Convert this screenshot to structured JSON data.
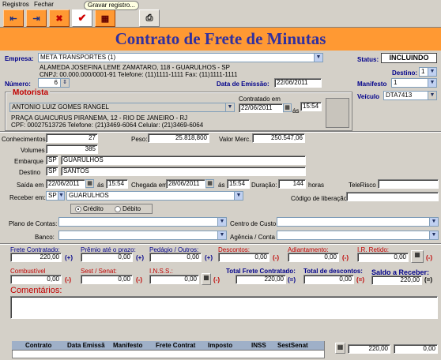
{
  "menu": {
    "registros": "Registros",
    "fechar": "Fechar"
  },
  "toolbar": {
    "tooltip": "Gravar registro..."
  },
  "title": "Contrato de Frete de Minutas",
  "empresa": {
    "label": "Empresa:",
    "value": "META TRANSPORTES (1)",
    "address": "ALAMEDA JOSEFINA LEME ZAMATARO, 118 - GUARULHOS - SP",
    "cnpj": "CNPJ: 00.000.000/0001-91 Telefone: (11)1111-1111 Fax: (11)1111-1111"
  },
  "status": {
    "label": "Status:",
    "value": "INCLUINDO"
  },
  "destino": {
    "label": "Destino:",
    "value": "1"
  },
  "manifesto": {
    "label": "Manifesto",
    "value": "1"
  },
  "veiculo": {
    "label": "Veículo",
    "value": "DTA7413"
  },
  "numero": {
    "label": "Número:",
    "value": "6"
  },
  "emissao": {
    "label": "Data de Emissão:",
    "value": "22/06/2011"
  },
  "motorista": {
    "label": "Motorista",
    "name": "ANTONIO LUIZ GOMES RANGEL",
    "address": "PRAÇA GUAICURUS PIRANEMA, 12 - RIO DE JANEIRO - RJ",
    "cpf": "CPF: 00027513726 Telefone: (21)3469-6064 Celular: (21)3469-6064",
    "contratado_label": "Contratado em",
    "contratado_date": "22/06/2011",
    "as": "ás",
    "contratado_time": "15:54"
  },
  "conhecimentos": {
    "label": "Conhecimentos:",
    "value": "27"
  },
  "peso": {
    "label": "Peso:",
    "value": "25.818,800"
  },
  "valor_merc": {
    "label": "Valor Merc.",
    "value": "250.547,06"
  },
  "volumes": {
    "label": "Volumes",
    "value": "385"
  },
  "embarque": {
    "label": "Embarque",
    "uf": "SP",
    "city": "GUARULHOS"
  },
  "destino2": {
    "label": "Destino",
    "uf": "SP",
    "city": "SANTOS"
  },
  "saida": {
    "label": "Saída em",
    "date": "22/06/2011",
    "as": "ás",
    "time": "15:54"
  },
  "chegada": {
    "label": "Chegada em",
    "date": "28/06/2011",
    "as": "ás",
    "time": "15:54"
  },
  "duracao": {
    "label": "Duração:",
    "value": "144",
    "unit": "horas"
  },
  "telerisco": {
    "label": "TeleRisco"
  },
  "receber": {
    "label": "Receber em:",
    "uf": "SP",
    "city": "GUARULHOS"
  },
  "codigo_lib": {
    "label": "Código de liberação"
  },
  "pagamento": {
    "credito": "Crédito",
    "debito": "Débito"
  },
  "plano_contas": {
    "label": "Plano de Contas:"
  },
  "centro_custo": {
    "label": "Centro de Custo"
  },
  "banco": {
    "label": "Banco:"
  },
  "agencia": {
    "label": "Agência / Conta"
  },
  "valores": {
    "frete_contratado": {
      "label": "Frete Contratado:",
      "value": "220,00",
      "sign": "(+)"
    },
    "premio": {
      "label": "Prêmio até o prazo:",
      "value": "0,00",
      "sign": "(+)"
    },
    "pedagio": {
      "label": "Pedágio / Outros:",
      "value": "0,00",
      "sign": "(+)"
    },
    "descontos": {
      "label": "Descontos:",
      "value": "0,00",
      "sign": "(-)"
    },
    "adiantamento": {
      "label": "Adiantamento:",
      "value": "0,00",
      "sign": "(-)"
    },
    "ir_retido": {
      "label": "I.R. Retido:",
      "value": "0,00",
      "sign": "(-)"
    },
    "combustivel": {
      "label": "Combustível",
      "value": "0,00",
      "sign": "(-)"
    },
    "sest_senat": {
      "label": "Sest / Senat:",
      "value": "0,00",
      "sign": "(-)"
    },
    "inss": {
      "label": "I.N.S.S.:",
      "value": "0,00"
    },
    "total_frete": {
      "label": "Total Frete Contratado:",
      "value": "220,00",
      "sign": "(=)"
    },
    "total_descontos": {
      "label": "Total de descontos:",
      "value": "0,00",
      "sign": "(=)"
    },
    "saldo": {
      "label": "Saldo a Receber:",
      "value": "220,00",
      "sign": "(=)"
    }
  },
  "comentarios": {
    "label": "Comentários:"
  },
  "grid": {
    "columns": [
      "Contrato",
      "Data Emissã",
      "Manifesto",
      "Frete Contrat",
      "Imposto",
      "INSS",
      "SestSenat"
    ]
  },
  "totals": {
    "frete": "220,00",
    "imposto": "0,00"
  }
}
